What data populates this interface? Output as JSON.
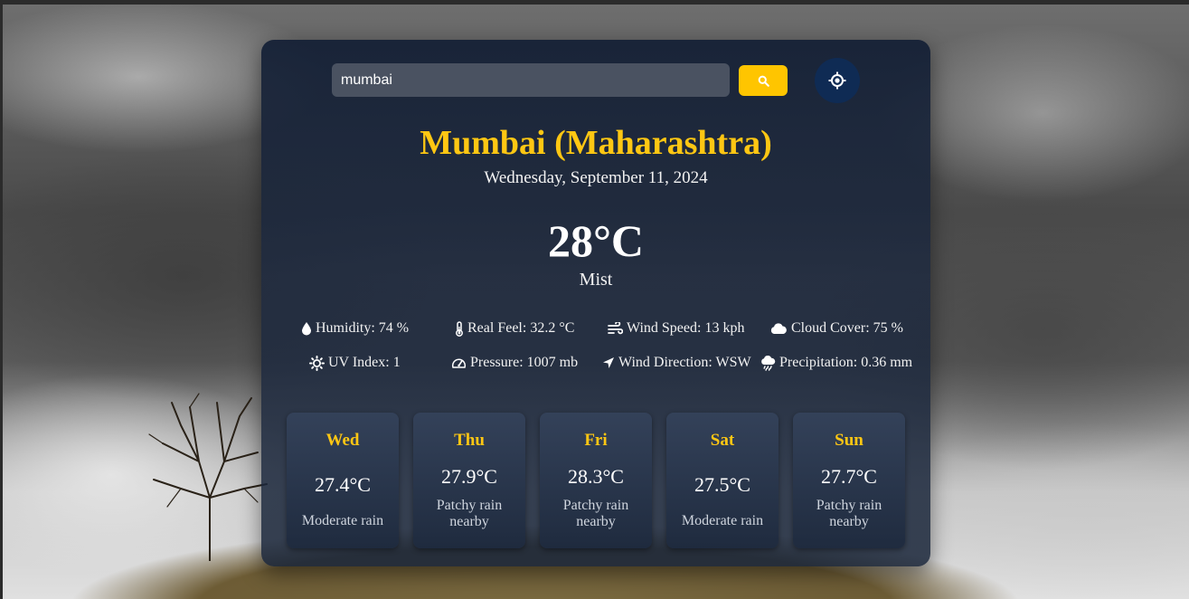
{
  "search": {
    "value": "mumbai"
  },
  "location": {
    "city": "Mumbai (Maharashtra)",
    "date": "Wednesday, September 11, 2024"
  },
  "current": {
    "temperature": "28°C",
    "condition": "Mist"
  },
  "stats": {
    "humidity": "Humidity: 74 %",
    "real_feel": "Real Feel: 32.2 °C",
    "wind_speed": "Wind Speed: 13 kph",
    "cloud_cover": "Cloud Cover: 75 %",
    "uv_index": "UV Index: 1",
    "pressure": "Pressure: 1007 mb",
    "wind_direction": "Wind Direction: WSW",
    "precipitation": "Precipitation: 0.36 mm"
  },
  "forecast": [
    {
      "day": "Wed",
      "temp": "27.4°C",
      "condition": "Moderate rain"
    },
    {
      "day": "Thu",
      "temp": "27.9°C",
      "condition": "Patchy rain nearby"
    },
    {
      "day": "Fri",
      "temp": "28.3°C",
      "condition": "Patchy rain nearby"
    },
    {
      "day": "Sat",
      "temp": "27.5°C",
      "condition": "Moderate rain"
    },
    {
      "day": "Sun",
      "temp": "27.7°C",
      "condition": "Patchy rain nearby"
    }
  ],
  "colors": {
    "accent": "#ffc713",
    "search_button": "#ffc500",
    "location_button": "#0f2b54"
  },
  "icons": {
    "search": "search-icon",
    "location": "crosshair-icon",
    "humidity": "droplet-icon",
    "real_feel": "thermometer-icon",
    "wind_speed": "wind-icon",
    "cloud_cover": "cloud-icon",
    "uv_index": "sun-icon",
    "pressure": "gauge-icon",
    "wind_direction": "location-arrow-icon",
    "precipitation": "cloud-rain-icon"
  }
}
